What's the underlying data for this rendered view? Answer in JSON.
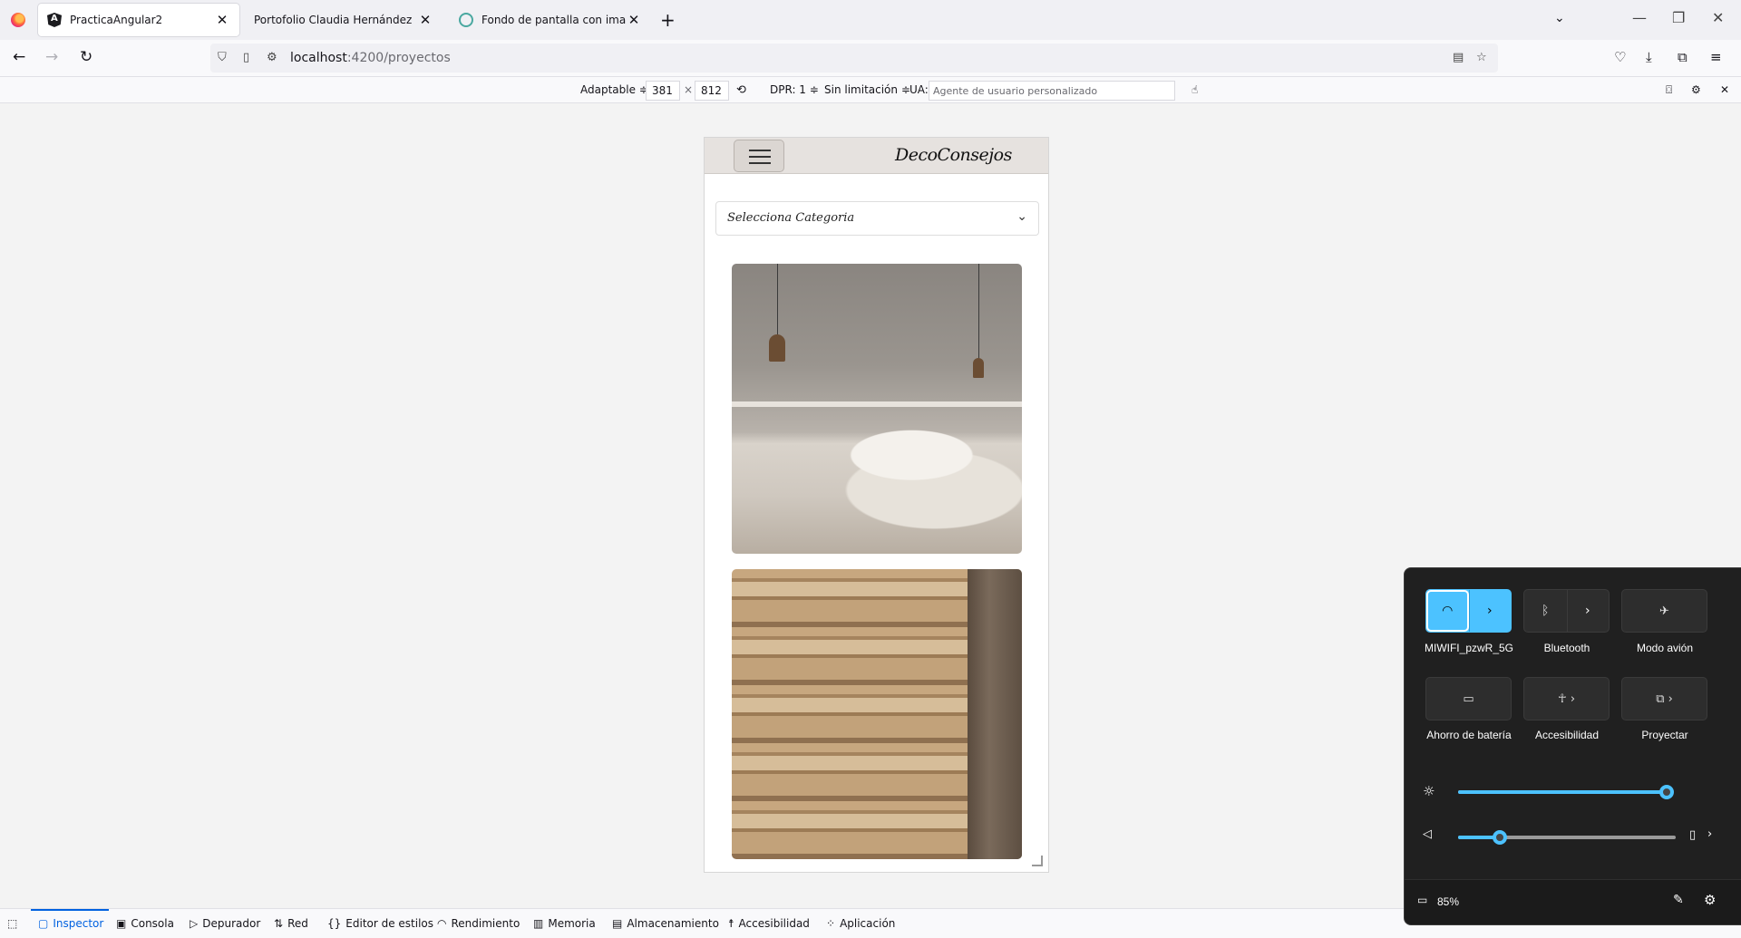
{
  "browser": {
    "tabs": [
      {
        "title": "PracticaAngular2",
        "icon": "angular-icon",
        "active": true
      },
      {
        "title": "Portofolio Claudia Hernández",
        "icon": "blank-page-icon",
        "active": false
      },
      {
        "title": "Fondo de pantalla con imagen",
        "icon": "chatgpt-icon",
        "active": false
      }
    ],
    "url_host": "localhost",
    "url_path": ":4200/proyectos"
  },
  "rdm": {
    "preset": "Adaptable ≑",
    "width": "381",
    "times": "×",
    "height": "812",
    "dpr": "DPR: 1 ≑",
    "throttle": "Sin limitación ≑",
    "ua_label": "UA:",
    "ua_placeholder": "Agente de usuario personalizado"
  },
  "site": {
    "brand": "DecoConsejos",
    "select_label": "Selecciona Categoria",
    "images": [
      "bedroom-photo",
      "jute-rugs-photo"
    ]
  },
  "devtools": {
    "tabs": [
      "Inspector",
      "Consola",
      "Depurador",
      "Red",
      "Editor de estilos",
      "Rendimiento",
      "Memoria",
      "Almacenamiento",
      "Accesibilidad",
      "Aplicación"
    ],
    "active": "Inspector"
  },
  "quick_settings": {
    "tiles": [
      "MIWIFI_pzwR_5G",
      "Bluetooth",
      "Modo avión",
      "Ahorro de batería",
      "Accesibilidad",
      "Proyectar"
    ],
    "wifi_on": true,
    "brightness": 0.99,
    "volume": 0.19,
    "battery": "85%",
    "accent_color": "#4cc2ff"
  }
}
